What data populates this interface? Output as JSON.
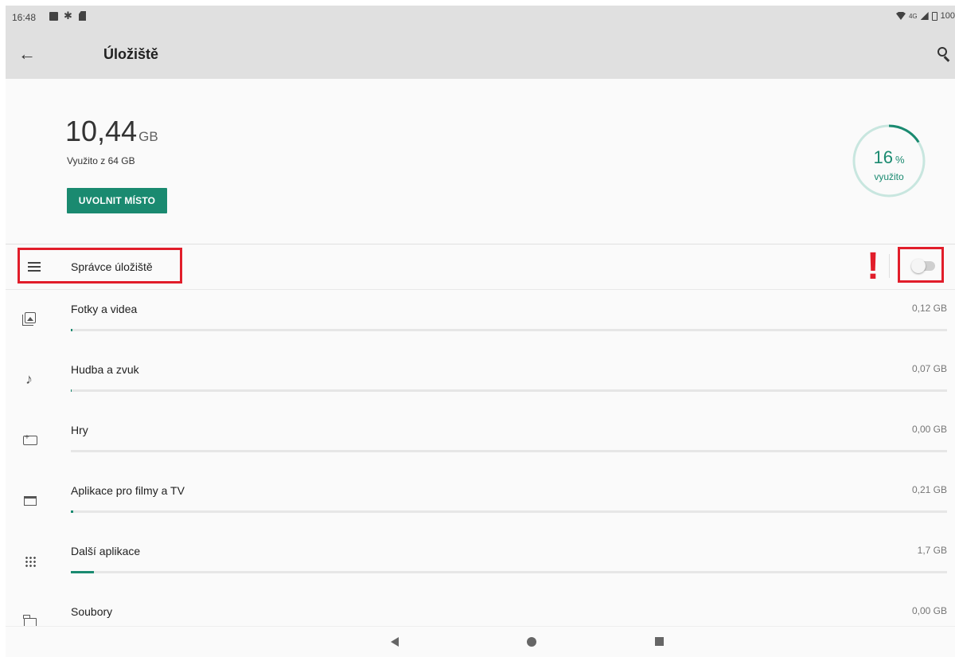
{
  "status_bar": {
    "time": "16:48",
    "network": "4G",
    "battery": "100"
  },
  "app_bar": {
    "title": "Úložiště"
  },
  "summary": {
    "used_value": "10,44",
    "used_unit": "GB",
    "used_of": "Využito z 64 GB",
    "free_button": "UVOLNIT MÍSTO",
    "percent_value": "16",
    "percent_sign": "%",
    "percent_label": "využito",
    "percent_fraction": 0.16,
    "accent_color": "#1a8a70"
  },
  "storage_manager": {
    "label": "Správce úložiště",
    "enabled": false,
    "annotation_mark": "!"
  },
  "categories": [
    {
      "label": "Fotky a videa",
      "size": "0,12 GB",
      "icon": "photo-icon",
      "fill_fraction": 0.002
    },
    {
      "label": "Hudba a zvuk",
      "size": "0,07 GB",
      "icon": "music-note-icon",
      "fill_fraction": 0.001
    },
    {
      "label": "Hry",
      "size": "0,00 GB",
      "icon": "gamepad-icon",
      "fill_fraction": 0.0
    },
    {
      "label": "Aplikace pro filmy a TV",
      "size": "0,21 GB",
      "icon": "clapperboard-icon",
      "fill_fraction": 0.003
    },
    {
      "label": "Další aplikace",
      "size": "1,7 GB",
      "icon": "apps-grid-icon",
      "fill_fraction": 0.026
    },
    {
      "label": "Soubory",
      "size": "0,00 GB",
      "icon": "folder-icon",
      "fill_fraction": 0.0
    }
  ],
  "highlight_color": "#e11d2a"
}
